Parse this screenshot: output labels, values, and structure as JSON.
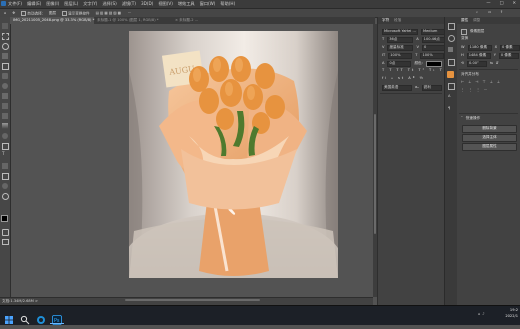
{
  "menu": {
    "items": [
      "文件(F)",
      "编辑(E)",
      "图像(I)",
      "图层(L)",
      "文字(Y)",
      "选择(S)",
      "滤镜(T)",
      "3D(D)",
      "视图(V)",
      "增效工具",
      "窗口(W)",
      "帮助(H)"
    ]
  },
  "options": {
    "items": [
      "自动选择:",
      "图层",
      "显示变换控件"
    ]
  },
  "tabs": [
    {
      "label": "IMG_20211005_2048.png @ 33.3% (RGB/8) *"
    },
    {
      "label": "未标题-1 @ 100% (图层 1, RGB/8) *"
    },
    {
      "label": "× 未标题-2 ..."
    }
  ],
  "status": {
    "text": "文档:1.34M/2.68M  >"
  },
  "panel1": {
    "tabs": [
      "字符",
      "段落"
    ],
    "font_family": "Microsoft YaHei ...",
    "font_style": "Medium",
    "size_a": "36点",
    "size_b": "100.46点",
    "leading_label": "度量标准",
    "tracking": "0",
    "scale_v": "100%",
    "scale_h": "100%",
    "baseline": "0点",
    "color_label": "颜色:",
    "lang": "美国英语",
    "aa": "锐利"
  },
  "panel2": {
    "tabs": [
      "属性",
      "调整"
    ],
    "section1": "变换",
    "w": "1180 像素",
    "h": "1484 像素",
    "x": "0 像素",
    "y": "0 像素",
    "angle": "0.00°",
    "section2": "对齐并分布",
    "section3": "快速操作",
    "btn1": "删除背景",
    "btn2": "选择主体",
    "btn3": "图层属性"
  },
  "clock": {
    "time": "19:2",
    "date": "2022/1"
  },
  "colors": {
    "menubar": "#3b3b3b",
    "workspace": "#535353",
    "panel": "#424242",
    "taskbar": "#1c2027",
    "accent_orange": "#e7933f"
  }
}
